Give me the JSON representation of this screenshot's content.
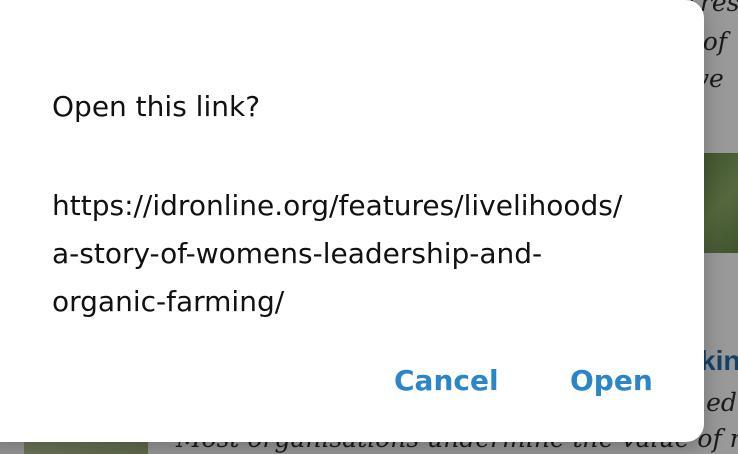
{
  "background": {
    "text_lines": [
      "r res",
      "e of",
      "ave"
    ],
    "article_title_fragment": "kin",
    "article_line_fragment": "ned",
    "bottom_line": "Most organisations undermine the value of res"
  },
  "dialog": {
    "title": "Open this link?",
    "url_lines": [
      "https://idronline.org/features/livelihoods/",
      "a-story-of-womens-leadership-and-",
      "organic-farming/"
    ],
    "cancel_label": "Cancel",
    "open_label": "Open"
  },
  "colors": {
    "accent": "#2a86c8",
    "dialog_bg": "#ffffff",
    "text": "#111111"
  }
}
